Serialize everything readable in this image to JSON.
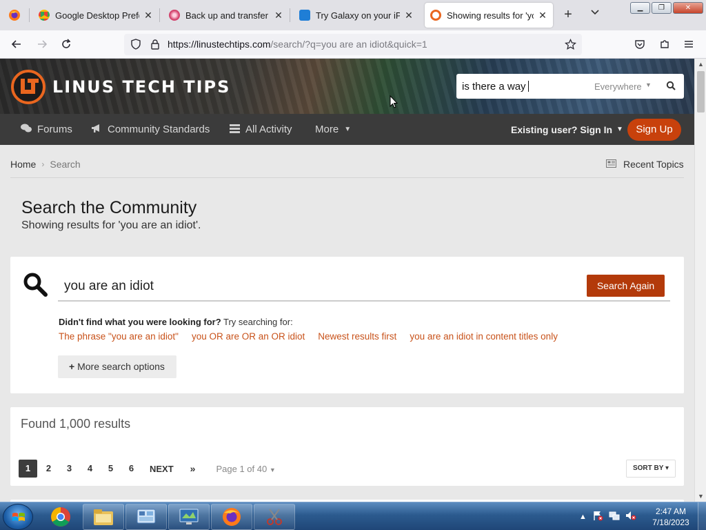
{
  "browser": {
    "tabs": [
      {
        "title": "Google Desktop Preferen",
        "favicon_color": "#4285f4",
        "active": false
      },
      {
        "title": "Back up and transfer you",
        "favicon_color": "#d23f6a",
        "active": false
      },
      {
        "title": "Try Galaxy on your iPhon",
        "favicon_color": "#1f7ed6",
        "active": false
      },
      {
        "title": "Showing results for 'you",
        "favicon_color": "#e9661f",
        "active": true
      }
    ],
    "url_host": "https://linustechtips.com",
    "url_path": "/search/?q=you are an idiot&quick=1"
  },
  "site": {
    "logo_text": "LINUS TECH TIPS",
    "header_search": {
      "value": "is there a way",
      "scope": "Everywhere"
    },
    "nav": {
      "items": [
        "Forums",
        "Community Standards",
        "All Activity",
        "More"
      ],
      "signin": "Existing user? Sign In",
      "signup": "Sign Up"
    },
    "breadcrumb": {
      "home": "Home",
      "current": "Search"
    },
    "recent_topics": "Recent Topics"
  },
  "main": {
    "title": "Search the Community",
    "subtitle": "Showing results for 'you are an idiot'.",
    "search": {
      "value": "you are an idiot",
      "button": "Search Again"
    },
    "suggest": {
      "lead_bold": "Didn't find what you were looking for?",
      "lead_rest": " Try searching for:",
      "links": [
        "The phrase \"you are an idiot\"",
        "you OR are OR an OR idiot",
        "Newest results first",
        "you are an idiot in content titles only"
      ]
    },
    "more_options": "More search options",
    "results": {
      "found": "Found 1,000 results",
      "pages": [
        "1",
        "2",
        "3",
        "4",
        "5",
        "6"
      ],
      "next": "NEXT",
      "last": "»",
      "page_info": "Page 1 of 40",
      "sort_by": "SORT BY"
    }
  },
  "taskbar": {
    "time": "2:47 AM",
    "date": "7/18/2023"
  },
  "colors": {
    "accent": "#c8410c",
    "link": "#c8521a",
    "nav_bg": "#3b3b3b"
  }
}
